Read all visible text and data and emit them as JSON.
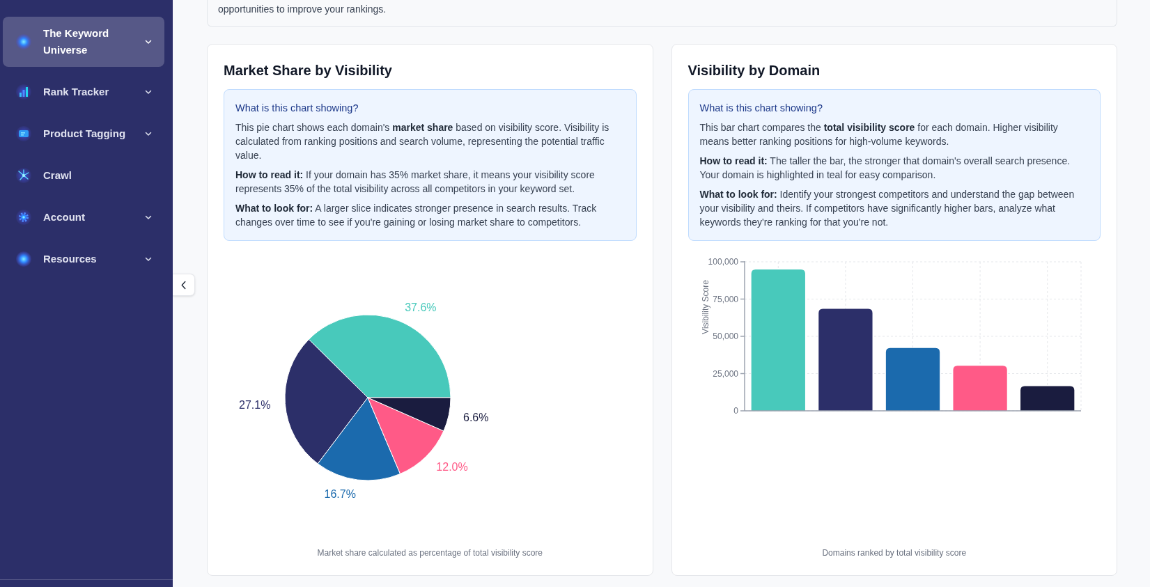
{
  "sidebar": {
    "items": [
      {
        "label": "The Keyword Universe",
        "selected": true,
        "expandable": true
      },
      {
        "label": "Rank Tracker",
        "selected": false,
        "expandable": true
      },
      {
        "label": "Product Tagging",
        "selected": false,
        "expandable": true
      },
      {
        "label": "Crawl",
        "selected": false,
        "expandable": false
      },
      {
        "label": "Account",
        "selected": false,
        "expandable": true
      },
      {
        "label": "Resources",
        "selected": false,
        "expandable": true
      }
    ]
  },
  "intro_card": {
    "text": "opportunities to improve your rankings."
  },
  "panels": [
    {
      "title": "Market Share by Visibility",
      "info": {
        "heading": "What is this chart showing?",
        "paragraphs": [
          "This pie chart shows each domain's **market share** based on visibility score. Visibility is calculated from ranking positions and search volume, representing the potential traffic value.",
          "**How to read it:** If your domain has 35% market share, it means your visibility score represents 35% of the total visibility across all competitors in your keyword set.",
          "**What to look for:** A larger slice indicates stronger presence in search results. Track changes over time to see if you're gaining or losing market share to competitors."
        ]
      },
      "chart_data": {
        "type": "pie",
        "values": [
          37.6,
          27.1,
          16.7,
          12.0,
          6.6
        ],
        "colors": [
          "#48c9bb",
          "#2c2f69",
          "#1b6aad",
          "#ff5a87",
          "#1a1c3f"
        ],
        "value_labels": [
          "37.6%",
          "27.1%",
          "16.7%",
          "12.0%",
          "6.6%"
        ]
      },
      "caption": "Market share calculated as percentage of total visibility score"
    },
    {
      "title": "Visibility by Domain",
      "info": {
        "heading": "What is this chart showing?",
        "paragraphs": [
          "This bar chart compares the **total visibility score** for each domain. Higher visibility means better ranking positions for high-volume keywords.",
          "**How to read it:** The taller the bar, the stronger that domain's overall search presence. Your domain is highlighted in teal for easy comparison.",
          "**What to look for:** Identify your strongest competitors and understand the gap between your visibility and theirs. If competitors have significantly higher bars, analyze what keywords they're ranking for that you're not."
        ]
      },
      "chart_data": {
        "type": "bar",
        "ylabel": "Visibility Score",
        "values": [
          94900,
          68400,
          42200,
          30300,
          16600
        ],
        "colors": [
          "#48c9bb",
          "#2c2f69",
          "#1b6aad",
          "#ff5a87",
          "#1a1c3f"
        ],
        "ylim": [
          0,
          100000
        ],
        "yticks": [
          {
            "value": 0,
            "label": "0"
          },
          {
            "value": 25000,
            "label": "25,000"
          },
          {
            "value": 50000,
            "label": "50,000"
          },
          {
            "value": 75000,
            "label": "75,000"
          },
          {
            "value": 100000,
            "label": "100,000"
          }
        ],
        "grid": true
      },
      "caption": "Domains ranked by total visibility score"
    }
  ]
}
